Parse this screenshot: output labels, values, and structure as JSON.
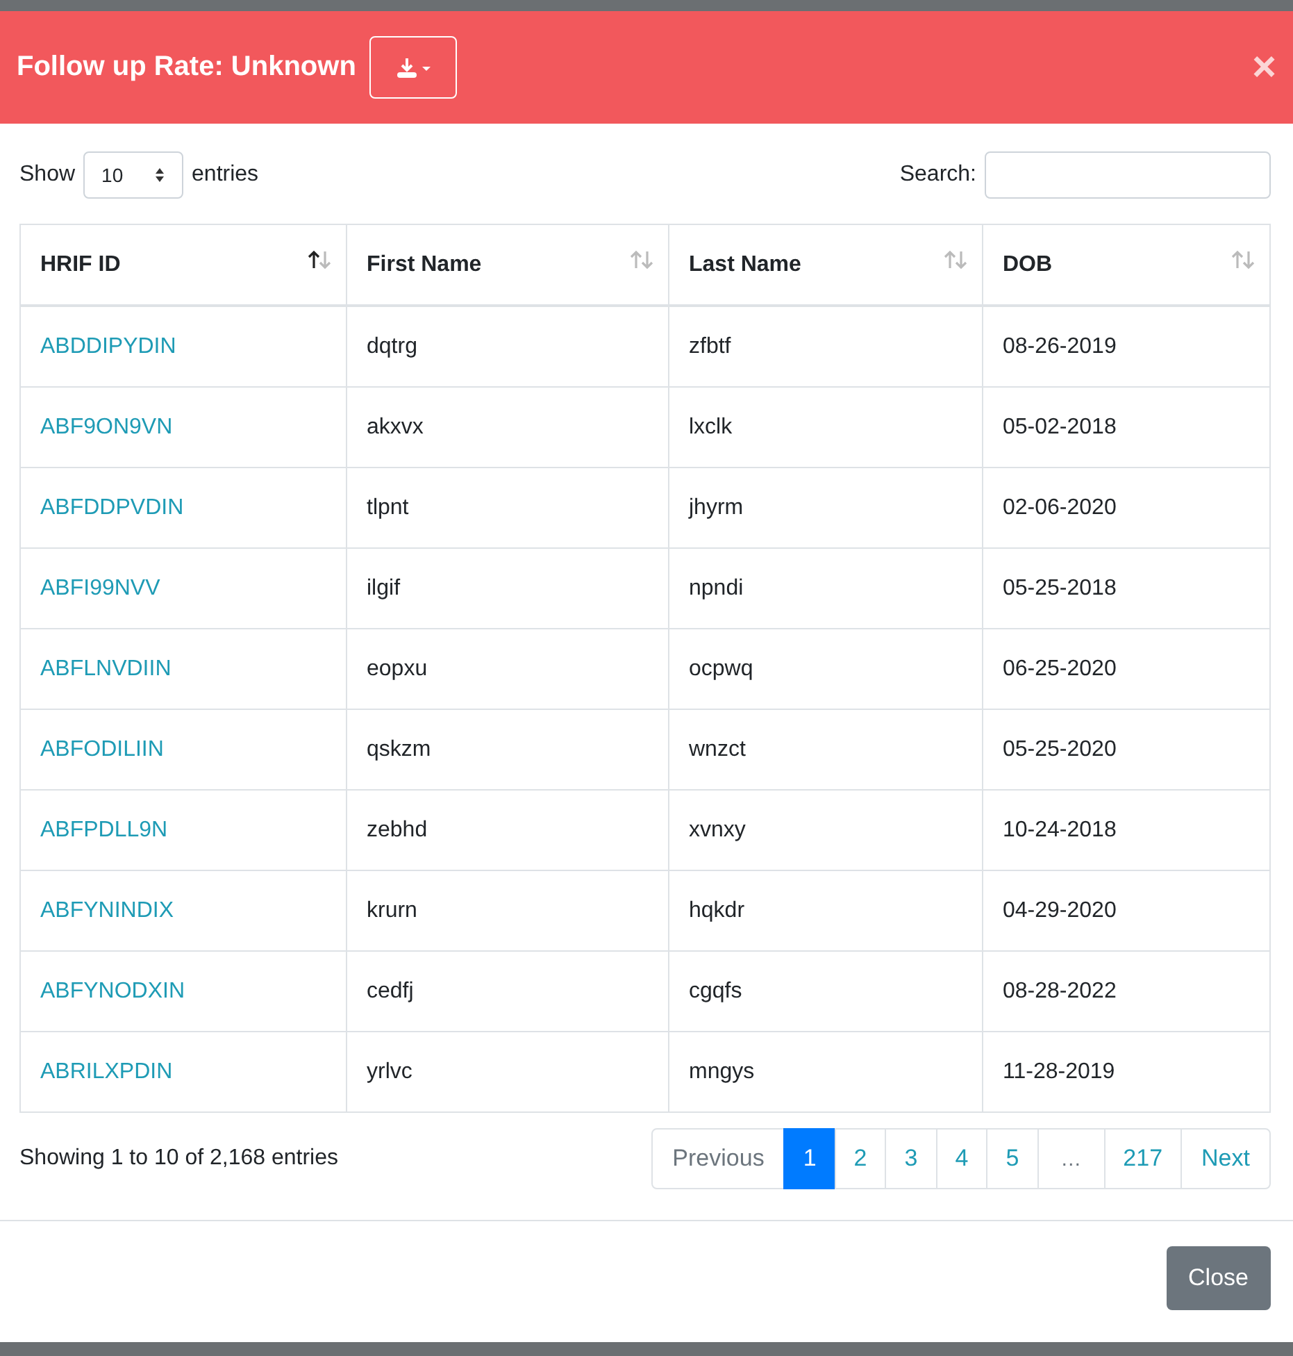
{
  "modal": {
    "title": "Follow up Rate: Unknown",
    "close_glyph": "×"
  },
  "length": {
    "prefix": "Show",
    "value": "10",
    "suffix": "entries"
  },
  "search": {
    "label": "Search:"
  },
  "table": {
    "columns": [
      {
        "label": "HRIF ID",
        "sorted": true
      },
      {
        "label": "First Name",
        "sorted": false
      },
      {
        "label": "Last Name",
        "sorted": false
      },
      {
        "label": "DOB",
        "sorted": false
      }
    ],
    "rows": [
      [
        "ABDDIPYDIN",
        "dqtrg",
        "zfbtf",
        "08-26-2019"
      ],
      [
        "ABF9ON9VN",
        "akxvx",
        "lxclk",
        "05-02-2018"
      ],
      [
        "ABFDDPVDIN",
        "tlpnt",
        "jhyrm",
        "02-06-2020"
      ],
      [
        "ABFI99NVV",
        "ilgif",
        "npndi",
        "05-25-2018"
      ],
      [
        "ABFLNVDIIN",
        "eopxu",
        "ocpwq",
        "06-25-2020"
      ],
      [
        "ABFODILIIN",
        "qskzm",
        "wnzct",
        "05-25-2020"
      ],
      [
        "ABFPDLL9N",
        "zebhd",
        "xvnxy",
        "10-24-2018"
      ],
      [
        "ABFYNINDIX",
        "krurn",
        "hqkdr",
        "04-29-2020"
      ],
      [
        "ABFYNODXIN",
        "cedfj",
        "cgqfs",
        "08-28-2022"
      ],
      [
        "ABRILXPDIN",
        "yrlvc",
        "mngys",
        "11-28-2019"
      ]
    ]
  },
  "info": "Showing 1 to 10 of 2,168 entries",
  "pagination": [
    {
      "label": "Previous",
      "kind": "nav",
      "selected": false,
      "disabled": true
    },
    {
      "label": "1",
      "kind": "page",
      "selected": true,
      "disabled": false
    },
    {
      "label": "2",
      "kind": "page",
      "selected": false,
      "disabled": false
    },
    {
      "label": "3",
      "kind": "page",
      "selected": false,
      "disabled": false
    },
    {
      "label": "4",
      "kind": "page",
      "selected": false,
      "disabled": false
    },
    {
      "label": "5",
      "kind": "page",
      "selected": false,
      "disabled": false
    },
    {
      "label": "…",
      "kind": "ellipsis",
      "selected": false,
      "disabled": true
    },
    {
      "label": "217",
      "kind": "page",
      "selected": false,
      "disabled": false
    },
    {
      "label": "Next",
      "kind": "nav",
      "selected": false,
      "disabled": false
    }
  ],
  "footer": {
    "close_button": "Close"
  }
}
